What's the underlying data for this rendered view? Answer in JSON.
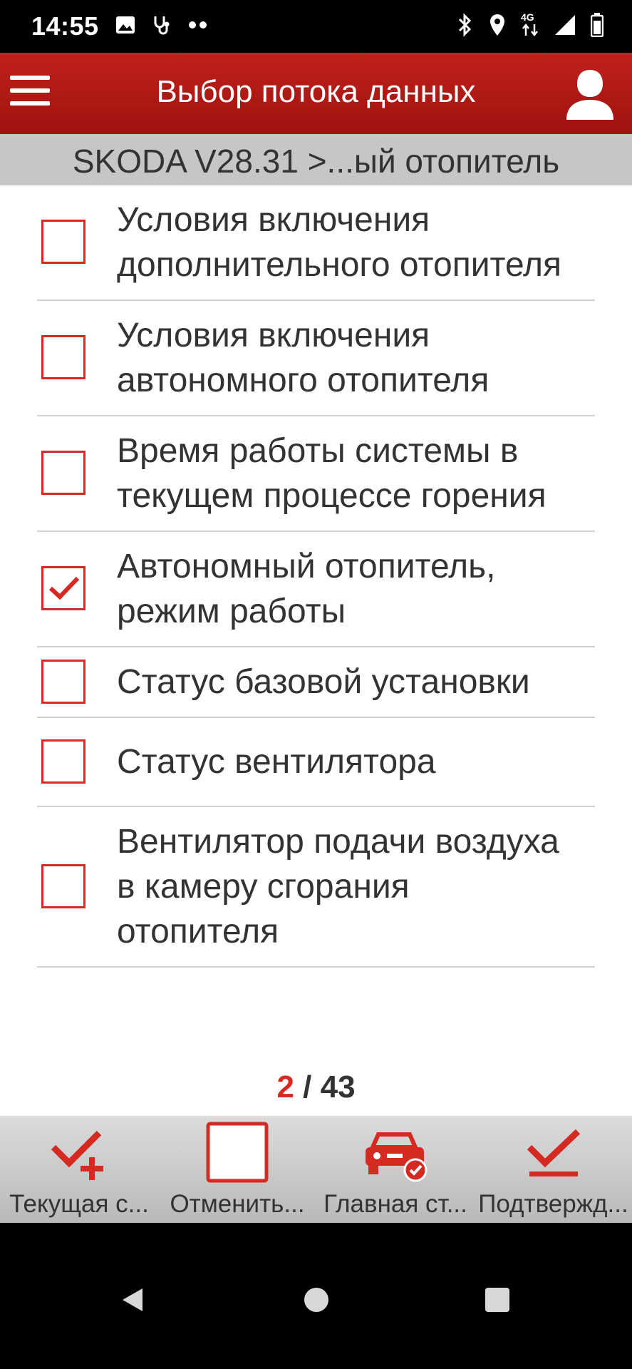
{
  "status_bar": {
    "time": "14:55",
    "network": "4G",
    "icons": [
      "image-icon",
      "stethoscope-icon",
      "more-dots-icon",
      "bluetooth-icon",
      "location-icon",
      "signal-icon",
      "battery-icon"
    ]
  },
  "app_bar": {
    "title": "Выбор потока данных",
    "menu_icon": "hamburger-menu-icon",
    "user_icon": "user-profile-icon"
  },
  "breadcrumb": "SKODA V28.31 >...ый отопитель",
  "items": [
    {
      "label": "Условия включения дополнительного отопителя",
      "checked": false
    },
    {
      "label": "Условия включения автономного отопителя",
      "checked": false
    },
    {
      "label": "Время работы системы в текущем процессе горения",
      "checked": false
    },
    {
      "label": "Автономный отопитель, режим работы",
      "checked": true
    },
    {
      "label": "Статус базовой установки",
      "checked": false
    },
    {
      "label": "Статус вентилятора",
      "checked": false
    },
    {
      "label": "Вентилятор подачи воздуха в камеру сгорания отопителя",
      "checked": false
    }
  ],
  "pager": {
    "current": "2",
    "separator": " / ",
    "total": "43"
  },
  "toolbar": [
    {
      "label": "Текущая с...",
      "icon": "check-plus-icon"
    },
    {
      "label": "Отменить...",
      "icon": "empty-checkbox-icon"
    },
    {
      "label": "Главная ст...",
      "icon": "car-check-icon"
    },
    {
      "label": "Подтвержд...",
      "icon": "confirm-check-icon"
    }
  ],
  "colors": {
    "accent": "#d42a22",
    "appbar": "#b0181a",
    "toolbar": "#c8c8c8"
  }
}
